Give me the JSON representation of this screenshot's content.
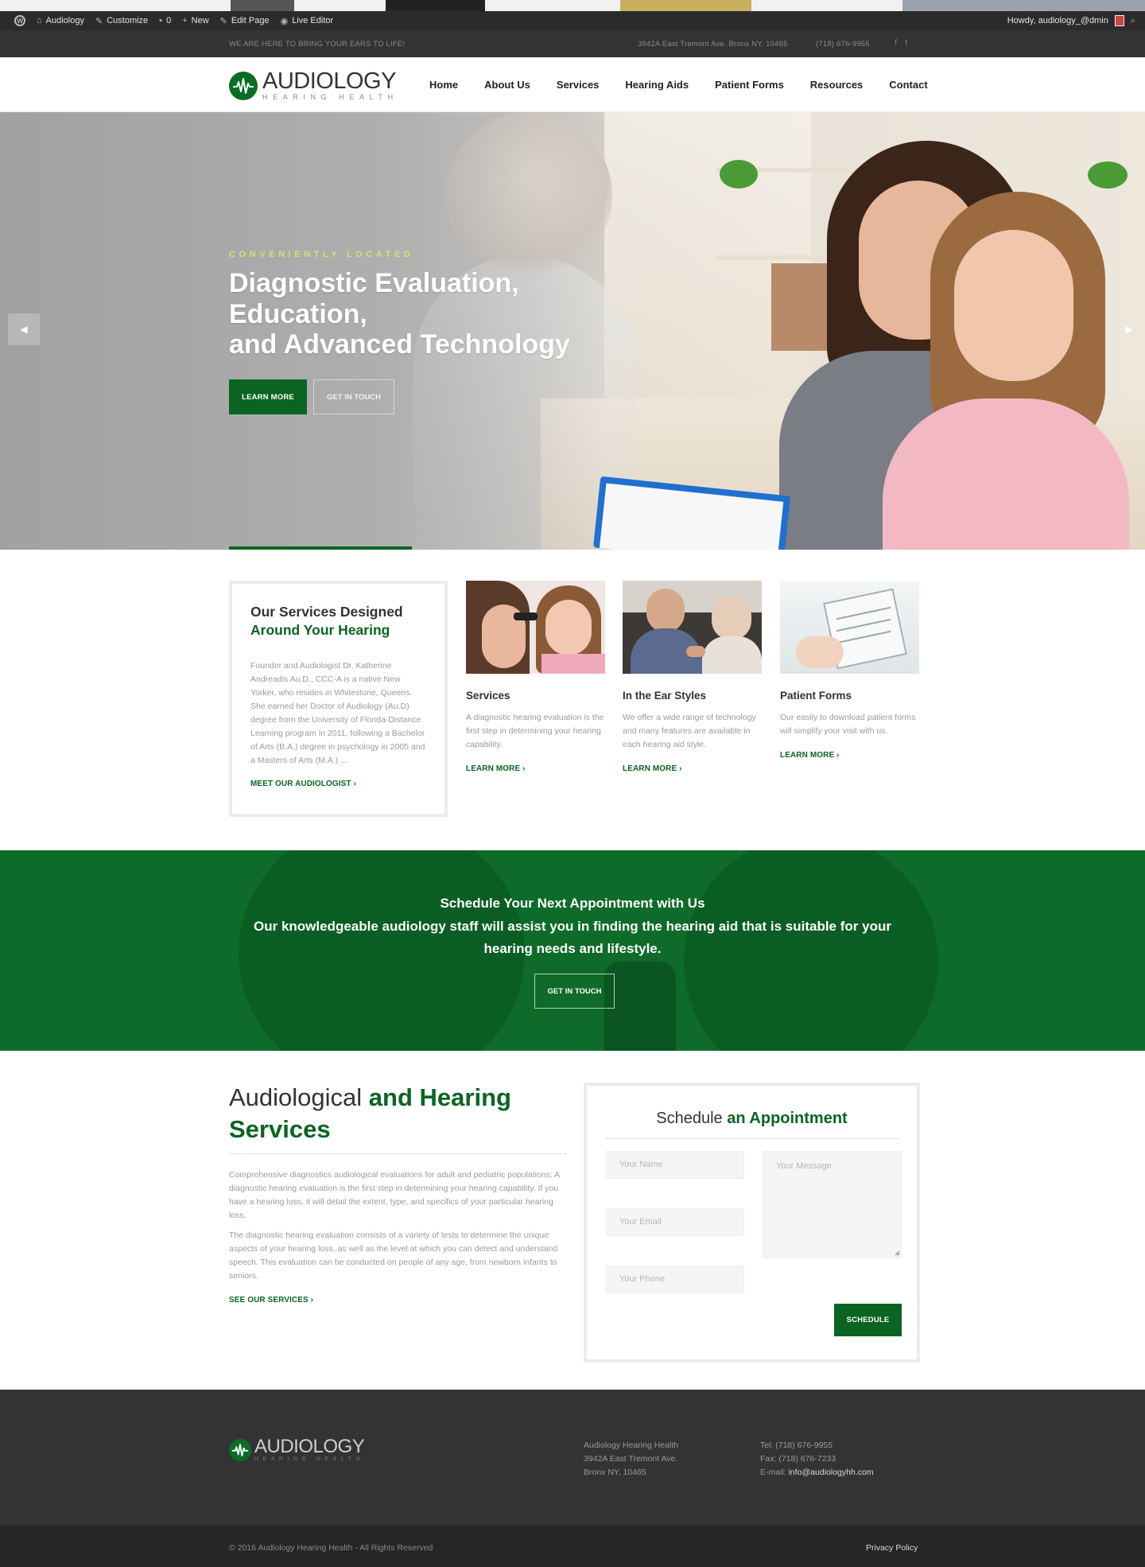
{
  "admin_bar": {
    "site_name": "Audiology",
    "customize": "Customize",
    "comments_count": "0",
    "new_label": "New",
    "edit_page": "Edit Page",
    "live_editor": "Live Editor",
    "howdy": "Howdy, audiology_@dmin"
  },
  "top_bar": {
    "tagline": "WE ARE HERE TO BRING YOUR EARS TO LIFE!",
    "address": "3942A East Tremont Ave. Bronx NY, 10465",
    "phone": "(718) 676-9955",
    "social": {
      "facebook": "f",
      "twitter": "t"
    }
  },
  "header": {
    "logo_brand": "AUDIOLOGY",
    "logo_sub": "HEARING HEALTH",
    "nav": [
      "Home",
      "About Us",
      "Services",
      "Hearing Aids",
      "Patient Forms",
      "Resources",
      "Contact"
    ]
  },
  "hero": {
    "kicker": "CONVENIENTLY LOCATED",
    "title_lines": [
      "Diagnostic Evaluation,",
      "Education,",
      "and Advanced Technology"
    ],
    "primary_button": "LEARN MORE",
    "secondary_button": "GET IN TOUCH",
    "prev_arrow": "◀",
    "next_arrow": "▶",
    "slide_progress": 0.16
  },
  "intro": {
    "title_line1": "Our Services Designed",
    "title_line2": "Around Your Hearing",
    "body": "Founder and Audiologist Dr. Katherine Andreadis Au.D., CCC-A is a native New Yorker, who resides in Whitestone, Queens. She earned her Doctor of Audiology (Au.D) degree from the University of Florida-Distance Learning program in 2011, following a Bachelor of Arts (B.A.) degree in psychology in 2005 and a Masters of Arts (M.A.) ...",
    "link": "MEET OUR AUDIOLOGIST  ›"
  },
  "cards": [
    {
      "title": "Services",
      "body": "A diagnostic hearing evaluation is the first step in determining your hearing capability.",
      "link": "LEARN MORE  ›"
    },
    {
      "title": "In the Ear Styles",
      "body": "We offer a wide range of technology and many features are available in each hearing aid style.",
      "link": "LEARN MORE  ›"
    },
    {
      "title": "Patient Forms",
      "body": "Our easily to download patient forms will simplify your visit with us.",
      "link": "LEARN MORE  ›"
    }
  ],
  "cta": {
    "heading": "Schedule Your Next Appointment with Us",
    "text": "Our knowledgeable audiology staff will assist you in finding the hearing aid that is suitable for your hearing needs and lifestyle.",
    "button": "GET IN TOUCH"
  },
  "audiological": {
    "title_plain": "Audiological ",
    "title_green1": "and Hearing",
    "title_green2": "Services",
    "para1": "Comprehensive diagnostics audiological evaluations for adult and pediatric populations: A diagnostic hearing evaluation is the first step in determining your hearing capability. If you have a hearing loss, it will detail the extent, type, and specifics of your particular hearing loss.",
    "para2": "The diagnostic hearing evaluation consists of a variety of tests to determine the unique aspects of your hearing loss, as well as the level at which you can detect and understand speech. This evaluation can be conducted on people of any age, from newborn infants to seniors.",
    "link": "SEE OUR SERVICES  ›"
  },
  "form": {
    "title_plain": "Schedule ",
    "title_green": "an Appointment",
    "name_placeholder": "Your Name",
    "email_placeholder": "Your Email",
    "phone_placeholder": "Your Phone",
    "message_placeholder": "Your Message",
    "submit": "SCHEDULE"
  },
  "footer": {
    "logo_brand": "AUDIOLOGY",
    "logo_sub": "HEARING HEALTH",
    "org": "Audiology Hearing Health",
    "street": "3942A East Tremont Ave.",
    "city": "Bronx NY, 10465",
    "tel": "Tel: (718) 676-9955",
    "fax": "Fax: (718) 676-7233",
    "email_label": "E-mail: ",
    "email": "info@audiologyhh.com",
    "copyright": "© 2016 Audiology Hearing Health - All Rights Reserved",
    "privacy": "Privacy Policy"
  },
  "colors": {
    "brand_green": "#0b6421",
    "dark_bar": "#333333",
    "admin_bar": "#2b2b2b",
    "kicker_lime": "#d4e36a"
  }
}
